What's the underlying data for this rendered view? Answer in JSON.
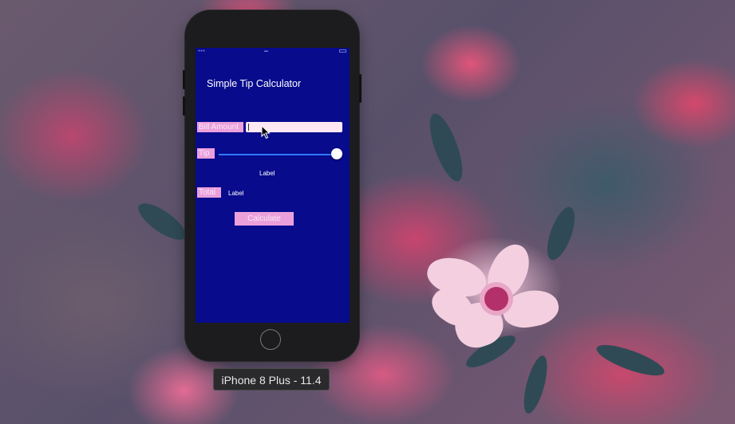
{
  "app": {
    "title": "Simple Tip Calculator",
    "bill_amount_label": "Bill Amount",
    "bill_amount_value": "",
    "tip_label": "Tip",
    "tip_slider_value": 1.0,
    "tip_value_label": "Label",
    "total_label": "Total",
    "total_value_label": "Label",
    "calculate_button": "Calculate"
  },
  "colors": {
    "app_background": "#070b8c",
    "label_background": "#eba0dc",
    "slider_track": "#2f7bff"
  },
  "simulator": {
    "device_label": "iPhone 8 Plus - 11.4"
  },
  "icons": {
    "cursor": "arrow-cursor-icon",
    "home": "home-button-icon"
  }
}
